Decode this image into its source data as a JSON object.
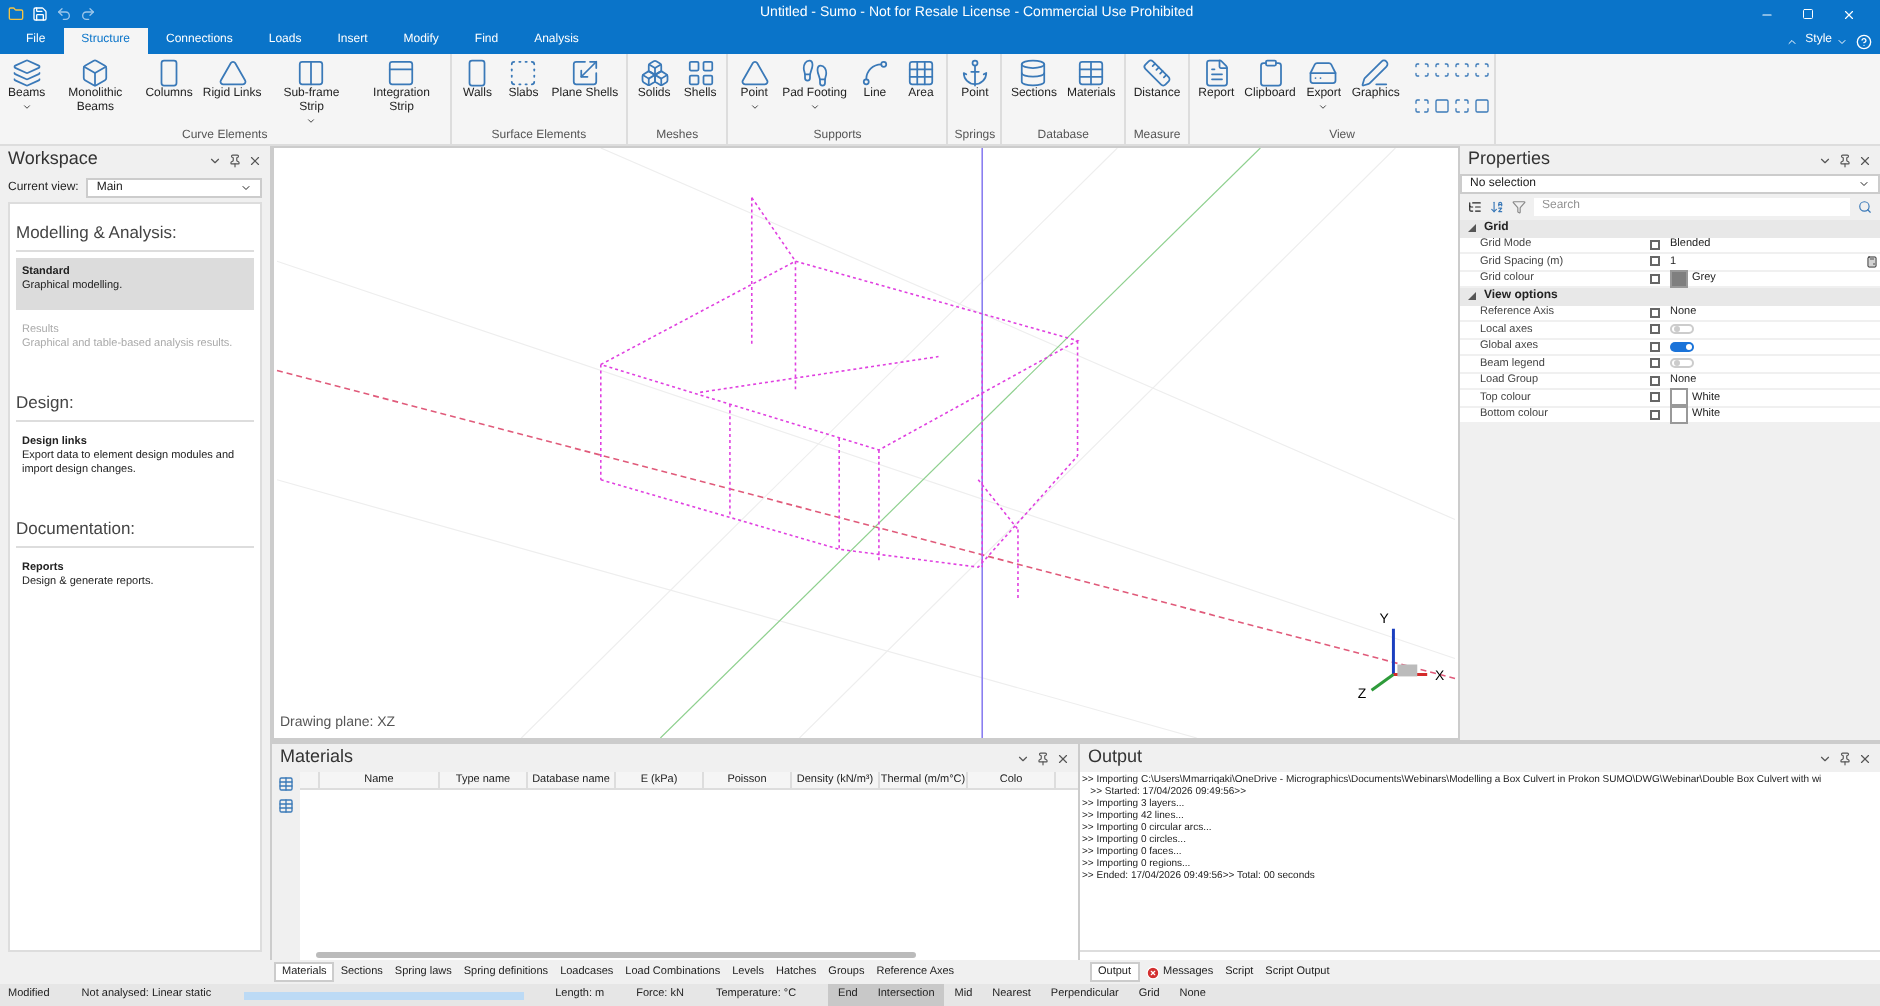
{
  "window": {
    "title": "Untitled - Sumo - Not for Resale License - Commercial Use Prohibited"
  },
  "ribbon_tabs": [
    {
      "label": "File",
      "selected": false
    },
    {
      "label": "Structure",
      "selected": true
    },
    {
      "label": "Connections",
      "selected": false
    },
    {
      "label": "Loads",
      "selected": false
    },
    {
      "label": "Insert",
      "selected": false
    },
    {
      "label": "Modify",
      "selected": false
    },
    {
      "label": "Find",
      "selected": false
    },
    {
      "label": "Analysis",
      "selected": false
    }
  ],
  "style_menu": {
    "label": "Style"
  },
  "ribbon_groups": [
    {
      "label": "Curve Elements",
      "buttons": [
        {
          "label": "Beams",
          "dropdown": true
        },
        {
          "label": "Monolithic Beams",
          "dropdown": false
        },
        {
          "label": "Columns",
          "dropdown": false
        },
        {
          "label": "Rigid Links",
          "dropdown": false
        },
        {
          "label": "Sub-frame Strip",
          "dropdown": true
        },
        {
          "label": "Integration Strip",
          "dropdown": false
        }
      ]
    },
    {
      "label": "Surface Elements",
      "buttons": [
        {
          "label": "Walls",
          "dropdown": false
        },
        {
          "label": "Slabs",
          "dropdown": false
        },
        {
          "label": "Plane Shells",
          "dropdown": false
        }
      ]
    },
    {
      "label": "Meshes",
      "buttons": [
        {
          "label": "Solids",
          "dropdown": false
        },
        {
          "label": "Shells",
          "dropdown": false
        }
      ]
    },
    {
      "label": "Supports",
      "buttons": [
        {
          "label": "Point",
          "dropdown": true
        },
        {
          "label": "Pad Footing",
          "dropdown": true
        },
        {
          "label": "Line",
          "dropdown": false
        },
        {
          "label": "Area",
          "dropdown": false
        }
      ]
    },
    {
      "label": "Springs",
      "buttons": [
        {
          "label": "Point",
          "dropdown": false
        }
      ]
    },
    {
      "label": "Database",
      "buttons": [
        {
          "label": "Sections",
          "dropdown": false
        },
        {
          "label": "Materials",
          "dropdown": false
        }
      ]
    },
    {
      "label": "Measure",
      "buttons": [
        {
          "label": "Distance",
          "dropdown": false
        }
      ]
    },
    {
      "label": "View",
      "buttons": [
        {
          "label": "Report",
          "dropdown": false
        },
        {
          "label": "Clipboard",
          "dropdown": false
        },
        {
          "label": "Export",
          "dropdown": true
        },
        {
          "label": "Graphics",
          "dropdown": false
        }
      ]
    }
  ],
  "workspace": {
    "title": "Workspace",
    "current_view_label": "Current view:",
    "current_view": "Main",
    "sections": [
      {
        "heading": "Modelling & Analysis:",
        "items": [
          {
            "title": "Standard",
            "description": "Graphical modelling.",
            "selected": true,
            "disabled": false
          },
          {
            "title": "Results",
            "description": "Graphical and table-based analysis results.",
            "selected": false,
            "disabled": true
          }
        ]
      },
      {
        "heading": "Design:",
        "items": [
          {
            "title": "Design links",
            "description": "Export data to element design modules and import design changes.",
            "selected": false,
            "disabled": false
          }
        ]
      },
      {
        "heading": "Documentation:",
        "items": [
          {
            "title": "Reports",
            "description": "Design & generate reports.",
            "selected": false,
            "disabled": false
          }
        ]
      }
    ]
  },
  "viewport": {
    "drawing_plane": "Drawing plane: XZ",
    "axes": {
      "x": "X",
      "y": "Y",
      "z": "Z"
    }
  },
  "properties": {
    "title": "Properties",
    "selection": "No selection",
    "search_placeholder": "Search",
    "groups": [
      {
        "label": "Grid",
        "expanded": true,
        "rows": [
          {
            "label": "Grid Mode",
            "kind": "text",
            "value": "Blended",
            "checked": false
          },
          {
            "label": "Grid Spacing (m)",
            "kind": "number",
            "value": "1",
            "checked": false
          },
          {
            "label": "Grid colour",
            "kind": "color",
            "value": "Grey",
            "color": "#7f7f7f",
            "checked": false
          }
        ]
      },
      {
        "label": "View options",
        "expanded": true,
        "rows": [
          {
            "label": "Reference Axis",
            "kind": "text",
            "value": "None",
            "checked": false
          },
          {
            "label": "Local axes",
            "kind": "toggle",
            "on": false,
            "checked": false
          },
          {
            "label": "Global axes",
            "kind": "toggle",
            "on": true,
            "checked": false
          },
          {
            "label": "Beam legend",
            "kind": "toggle",
            "on": false,
            "checked": false
          },
          {
            "label": "Load Group",
            "kind": "text",
            "value": "None",
            "checked": false
          },
          {
            "label": "Top colour",
            "kind": "color",
            "value": "White",
            "color": "#ffffff",
            "checked": false
          },
          {
            "label": "Bottom colour",
            "kind": "color",
            "value": "White",
            "color": "#ffffff",
            "checked": false
          }
        ]
      }
    ]
  },
  "materials": {
    "title": "Materials",
    "columns": [
      "Name",
      "Type name",
      "Database name",
      "E (kPa)",
      "Poisson",
      "Density (kN/m³)",
      "Thermal (m/m°C)",
      "Colo"
    ]
  },
  "output": {
    "title": "Output",
    "lines": [
      ">> Importing C:\\Users\\Mmarriqaki\\OneDrive - Micrographics\\Documents\\Webinars\\Modelling a Box Culvert in Prokon SUMO\\DWG\\Webinar\\Double Box Culvert with wi",
      "   >> Started: 17/04/2026 09:49:56>>",
      ">> Importing 3 layers...",
      ">> Importing 42 lines...",
      ">> Importing 0 circular arcs...",
      ">> Importing 0 circles...",
      ">> Importing 0 faces...",
      ">> Importing 0 regions...",
      ">> Ended: 17/04/2026 09:49:56>> Total: 00 seconds"
    ]
  },
  "bottom_tabs_left": [
    {
      "label": "Materials",
      "selected": true
    },
    {
      "label": "Sections",
      "selected": false
    },
    {
      "label": "Spring laws",
      "selected": false
    },
    {
      "label": "Spring definitions",
      "selected": false
    },
    {
      "label": "Loadcases",
      "selected": false
    },
    {
      "label": "Load Combinations",
      "selected": false
    },
    {
      "label": "Levels",
      "selected": false
    },
    {
      "label": "Hatches",
      "selected": false
    },
    {
      "label": "Groups",
      "selected": false
    },
    {
      "label": "Reference Axes",
      "selected": false
    }
  ],
  "bottom_tabs_right": [
    {
      "label": "Output",
      "selected": true,
      "kind": "plain"
    },
    {
      "label": "Messages",
      "selected": false,
      "kind": "error"
    },
    {
      "label": "Script",
      "selected": false,
      "kind": "plain"
    },
    {
      "label": "Script Output",
      "selected": false,
      "kind": "plain"
    }
  ],
  "status_bar": {
    "state": "Modified",
    "analysis": "Not analysed: Linear static",
    "progress": {
      "level": 1
    },
    "units": [
      "Length: m",
      "Force: kN",
      "Temperature: °C"
    ],
    "snaps": [
      {
        "label": "End",
        "selected": true
      },
      {
        "label": "Intersection",
        "selected": true
      },
      {
        "label": "Mid",
        "selected": false
      },
      {
        "label": "Nearest",
        "selected": false
      },
      {
        "label": "Perpendicular",
        "selected": false
      },
      {
        "label": "Grid",
        "selected": false
      },
      {
        "label": "None",
        "selected": false
      }
    ]
  }
}
